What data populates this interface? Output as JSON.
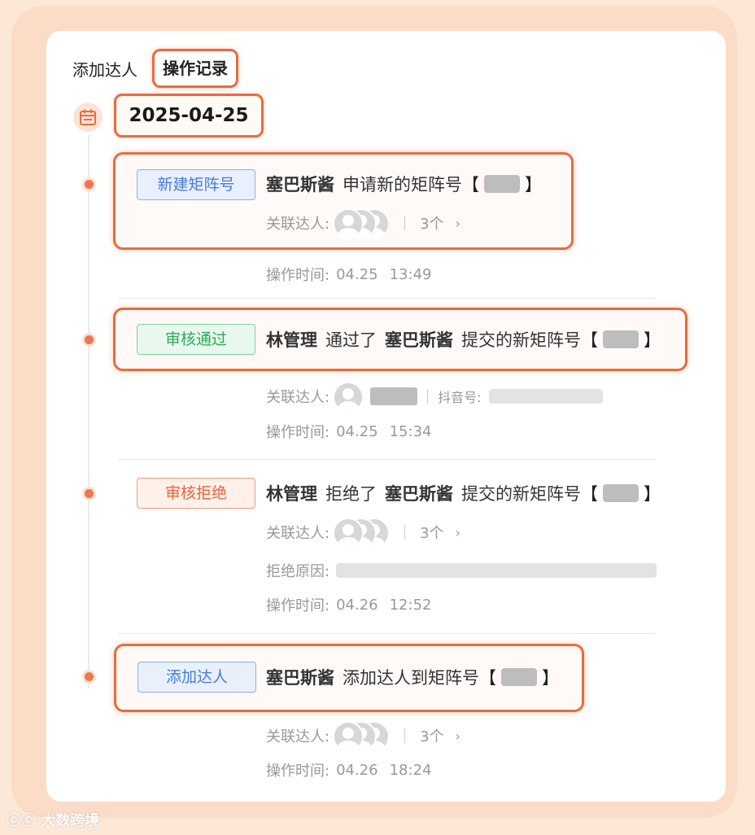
{
  "tabs": {
    "add": "添加达人",
    "log": "操作记录"
  },
  "date": "2025-04-25",
  "labels": {
    "related": "关联达人:",
    "op_time": "操作时间:",
    "douyin": "抖音号:",
    "reject_reason": "拒绝原因:"
  },
  "entries": [
    {
      "badge": "新建矩阵号",
      "actor": "塞巴斯酱",
      "action": "申请新的矩阵号",
      "bracket_open": "【",
      "bracket_close": "】",
      "count": "3个",
      "date": "04.25",
      "time": "13:49"
    },
    {
      "badge": "审核通过",
      "actor": "林管理",
      "action": "通过了",
      "target": "塞巴斯酱",
      "suffix": "提交的新矩阵号",
      "bracket_open": "【",
      "bracket_close": "】",
      "date": "04.25",
      "time": "15:34"
    },
    {
      "badge": "审核拒绝",
      "actor": "林管理",
      "action": "拒绝了",
      "target": "塞巴斯酱",
      "suffix": "提交的新矩阵号",
      "bracket_open": "【",
      "bracket_close": "】",
      "count": "3个",
      "date": "04.26",
      "time": "12:52"
    },
    {
      "badge": "添加达人",
      "actor": "塞巴斯酱",
      "action": "添加达人到矩阵号",
      "bracket_open": "【",
      "bracket_close": "】",
      "count": "3个",
      "date": "04.26",
      "time": "18:24"
    }
  ],
  "watermark": "大数跨境",
  "colors": {
    "accent": "#ea6b3d",
    "blue": "#4a7ad8",
    "green": "#2fa85a",
    "orange": "#e9643a"
  },
  "icons": {
    "calendar": "calendar-icon",
    "chevron": "chevron-right-icon",
    "avatar": "avatar-icon"
  }
}
